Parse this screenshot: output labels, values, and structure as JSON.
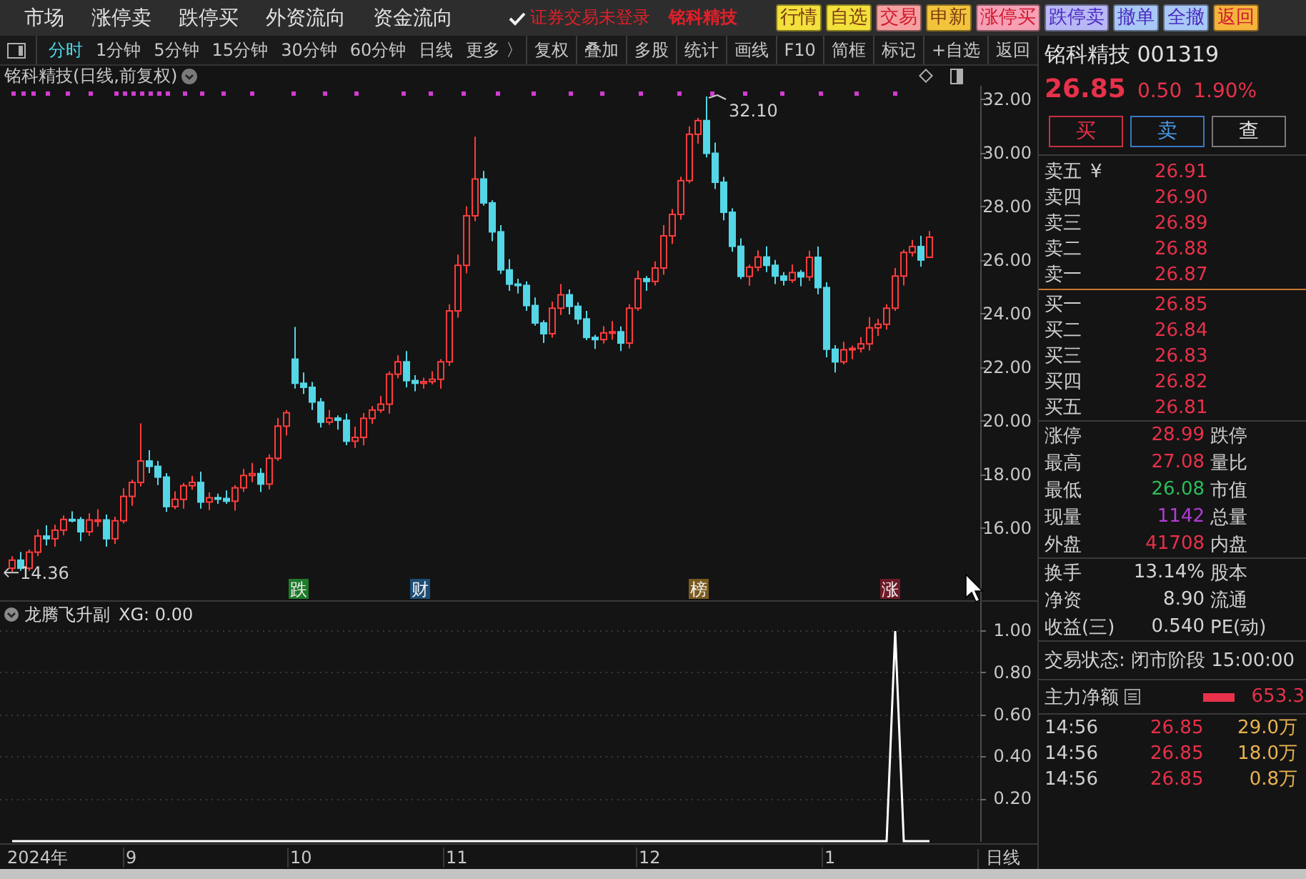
{
  "top_menu": {
    "items": [
      "市场",
      "涨停卖",
      "跌停买",
      "外资流向",
      "资金流向"
    ],
    "login_notice": "证券交易未登录",
    "stock_name": "铭科精技",
    "quick_buttons": [
      {
        "label": "行情",
        "color": "#f2e03c"
      },
      {
        "label": "自选",
        "color": "#f2e03c"
      },
      {
        "label": "交易",
        "color": "#f5a0a0"
      },
      {
        "label": "申新",
        "color": "#f2c43c"
      },
      {
        "label": "涨停买",
        "color": "#f5a0b4"
      },
      {
        "label": "跌停卖",
        "color": "#b8b8f5"
      },
      {
        "label": "撤单",
        "color": "#a8c8f5"
      },
      {
        "label": "全撤",
        "color": "#a8c8f5"
      },
      {
        "label": "返回",
        "color": "#f5b43c"
      }
    ]
  },
  "toolbar": {
    "periods": [
      {
        "label": "分时",
        "selected": true
      },
      {
        "label": "1分钟",
        "selected": false
      },
      {
        "label": "5分钟",
        "selected": false
      },
      {
        "label": "15分钟",
        "selected": false
      },
      {
        "label": "30分钟",
        "selected": false
      },
      {
        "label": "60分钟",
        "selected": false
      },
      {
        "label": "日线",
        "selected": false
      },
      {
        "label": "更多 〉",
        "selected": false
      }
    ],
    "tools": [
      "复权",
      "叠加",
      "多股",
      "统计",
      "画线",
      "F10",
      "简框",
      "标记",
      "+自选",
      "返回"
    ]
  },
  "chart": {
    "title": "铭科精技(日线,前复权)",
    "high_label": "32.10",
    "low_label": "14.36",
    "events": [
      {
        "label": "跌",
        "color": "#1f7a2a"
      },
      {
        "label": "财",
        "color": "#1d4d75"
      },
      {
        "label": "榜",
        "color": "#7a5a1e"
      },
      {
        "label": "涨",
        "color": "#6e1a28"
      }
    ],
    "chart_data": {
      "type": "candlestick",
      "ylim": [
        13.25,
        32.5
      ],
      "yticks": [
        {
          "value": 32,
          "label": "32.00"
        },
        {
          "value": 30,
          "label": "30.00"
        },
        {
          "value": 28,
          "label": "28.00"
        },
        {
          "value": 26,
          "label": "26.00"
        },
        {
          "value": 24,
          "label": "24.00"
        },
        {
          "value": 22,
          "label": "22.00"
        },
        {
          "value": 20,
          "label": "20.00"
        },
        {
          "value": 18,
          "label": "18.00"
        },
        {
          "value": 16,
          "label": "16.00"
        }
      ],
      "ohlc": [
        [
          14.5,
          14.95,
          14.36,
          14.8
        ],
        [
          14.8,
          15.1,
          14.4,
          14.5
        ],
        [
          14.5,
          15.2,
          14.4,
          15.1
        ],
        [
          15.1,
          15.95,
          14.95,
          15.7
        ],
        [
          15.7,
          16.1,
          15.35,
          15.6
        ],
        [
          15.6,
          16.12,
          15.3,
          15.92
        ],
        [
          15.92,
          16.47,
          15.72,
          16.32
        ],
        [
          16.32,
          16.62,
          16.21,
          16.31
        ],
        [
          16.31,
          16.41,
          15.51,
          15.86
        ],
        [
          15.86,
          16.55,
          15.71,
          16.3
        ],
        [
          16.3,
          16.7,
          16.05,
          16.3
        ],
        [
          16.3,
          16.5,
          15.3,
          15.6
        ],
        [
          15.6,
          16.42,
          15.4,
          16.27
        ],
        [
          16.27,
          17.48,
          16.17,
          17.18
        ],
        [
          17.18,
          17.8,
          16.83,
          17.7
        ],
        [
          17.7,
          19.9,
          17.55,
          18.5
        ],
        [
          18.5,
          18.9,
          18.05,
          18.3
        ],
        [
          18.3,
          18.5,
          17.6,
          17.9
        ],
        [
          17.9,
          18.05,
          16.6,
          16.8
        ],
        [
          16.8,
          17.37,
          16.7,
          17.07
        ],
        [
          17.07,
          17.68,
          16.72,
          17.58
        ],
        [
          17.58,
          17.95,
          17.43,
          17.7
        ],
        [
          17.7,
          18.1,
          16.72,
          16.97
        ],
        [
          16.97,
          17.33,
          16.67,
          17.13
        ],
        [
          17.13,
          17.28,
          16.9,
          17.1
        ],
        [
          17.1,
          17.4,
          16.9,
          17.0
        ],
        [
          17.0,
          17.6,
          16.65,
          17.5
        ],
        [
          17.5,
          18.21,
          17.35,
          17.96
        ],
        [
          17.96,
          18.43,
          17.71,
          18.03
        ],
        [
          18.03,
          18.23,
          17.34,
          17.64
        ],
        [
          17.64,
          18.75,
          17.44,
          18.6
        ],
        [
          18.6,
          20.1,
          18.5,
          19.8
        ],
        [
          19.8,
          20.4,
          19.45,
          20.3
        ],
        [
          22.3,
          23.5,
          21.2,
          21.4
        ],
        [
          21.4,
          21.8,
          21.0,
          21.25
        ],
        [
          21.25,
          21.45,
          20.4,
          20.7
        ],
        [
          20.7,
          20.85,
          19.75,
          19.95
        ],
        [
          19.95,
          20.4,
          19.85,
          20.1
        ],
        [
          20.1,
          20.2,
          19.67,
          20.02
        ],
        [
          20.02,
          20.27,
          19.09,
          19.24
        ],
        [
          19.24,
          19.78,
          18.99,
          19.38
        ],
        [
          19.38,
          20.29,
          19.08,
          20.09
        ],
        [
          20.09,
          20.55,
          19.89,
          20.4
        ],
        [
          20.4,
          20.92,
          20.3,
          20.62
        ],
        [
          20.62,
          21.84,
          20.27,
          21.74
        ],
        [
          21.74,
          22.45,
          21.59,
          22.2
        ],
        [
          22.2,
          22.6,
          21.25,
          21.5
        ],
        [
          21.5,
          21.7,
          21.1,
          21.4
        ],
        [
          21.4,
          21.61,
          21.2,
          21.46
        ],
        [
          21.46,
          21.85,
          21.36,
          21.55
        ],
        [
          21.55,
          22.3,
          21.2,
          22.2
        ],
        [
          22.2,
          24.35,
          22.05,
          24.1
        ],
        [
          24.1,
          26.2,
          23.85,
          25.8
        ],
        [
          25.8,
          28.0,
          25.5,
          27.65
        ],
        [
          27.65,
          30.6,
          27.45,
          29.02
        ],
        [
          29.02,
          29.32,
          28.03,
          28.13
        ],
        [
          28.13,
          28.23,
          26.7,
          27.05
        ],
        [
          27.05,
          27.3,
          25.48,
          25.63
        ],
        [
          25.63,
          26.03,
          24.85,
          25.1
        ],
        [
          25.1,
          25.3,
          24.75,
          25.05
        ],
        [
          25.05,
          25.2,
          24.1,
          24.3
        ],
        [
          24.3,
          24.6,
          23.55,
          23.65
        ],
        [
          23.65,
          23.75,
          22.9,
          23.25
        ],
        [
          23.25,
          24.45,
          23.1,
          24.2
        ],
        [
          24.2,
          25.1,
          23.95,
          24.7
        ],
        [
          24.7,
          24.9,
          23.97,
          24.27
        ],
        [
          24.27,
          24.42,
          23.6,
          23.8
        ],
        [
          23.8,
          24.1,
          23.01,
          23.11
        ],
        [
          23.11,
          23.21,
          22.68,
          23.03
        ],
        [
          23.03,
          23.53,
          22.88,
          23.28
        ],
        [
          23.28,
          23.72,
          23.03,
          23.32
        ],
        [
          23.32,
          23.52,
          22.6,
          22.9
        ],
        [
          22.9,
          24.35,
          22.7,
          24.2
        ],
        [
          24.2,
          25.6,
          24.1,
          25.3
        ],
        [
          25.3,
          25.4,
          24.85,
          25.2
        ],
        [
          25.2,
          25.95,
          25.05,
          25.7
        ],
        [
          25.7,
          27.3,
          25.45,
          26.9
        ],
        [
          26.9,
          27.9,
          26.6,
          27.7
        ],
        [
          27.7,
          29.11,
          27.5,
          28.96
        ],
        [
          28.96,
          30.99,
          28.86,
          30.69
        ],
        [
          30.69,
          31.3,
          30.34,
          31.2
        ],
        [
          31.2,
          32.1,
          29.83,
          29.98
        ],
        [
          29.98,
          30.38,
          28.65,
          28.9
        ],
        [
          28.9,
          29.1,
          27.48,
          27.78
        ],
        [
          27.78,
          27.93,
          26.31,
          26.51
        ],
        [
          26.51,
          26.81,
          25.29,
          25.39
        ],
        [
          25.39,
          25.83,
          25.04,
          25.73
        ],
        [
          25.73,
          26.36,
          25.58,
          26.11
        ],
        [
          26.11,
          26.51,
          25.55,
          25.8
        ],
        [
          25.8,
          26.0,
          25.1,
          25.4
        ],
        [
          25.4,
          25.55,
          25.05,
          25.25
        ],
        [
          25.25,
          25.83,
          25.15,
          25.53
        ],
        [
          25.53,
          25.63,
          25.02,
          25.37
        ],
        [
          25.37,
          26.35,
          25.22,
          26.1
        ],
        [
          26.1,
          26.5,
          24.72,
          24.97
        ],
        [
          24.97,
          25.17,
          22.37,
          22.67
        ],
        [
          22.67,
          22.82,
          21.8,
          22.2
        ],
        [
          22.2,
          22.95,
          22.1,
          22.65
        ],
        [
          22.65,
          22.8,
          22.3,
          22.7
        ],
        [
          22.7,
          23.12,
          22.55,
          22.87
        ],
        [
          22.87,
          23.87,
          22.62,
          23.47
        ],
        [
          23.47,
          23.8,
          23.17,
          23.6
        ],
        [
          23.6,
          24.35,
          23.4,
          24.2
        ],
        [
          24.2,
          25.7,
          24.1,
          25.4
        ],
        [
          25.4,
          26.38,
          25.05,
          26.28
        ],
        [
          26.28,
          26.75,
          26.13,
          26.5
        ],
        [
          26.5,
          26.9,
          25.75,
          26.0
        ],
        [
          26.1,
          27.08,
          26.08,
          26.85
        ]
      ]
    }
  },
  "indicator": {
    "name": "龙腾飞升副",
    "reading": "XG: 0.00",
    "chart_data": {
      "type": "line",
      "grid": true,
      "ylim": [
        0,
        1
      ],
      "yticks": [
        {
          "value": 1,
          "label": "1.00"
        },
        {
          "value": 0.8,
          "label": "0.80"
        },
        {
          "value": 0.6,
          "label": "0.60"
        },
        {
          "value": 0.4,
          "label": "0.40"
        },
        {
          "value": 0.2,
          "label": "0.20"
        }
      ],
      "values": [
        0,
        0,
        0,
        0,
        0,
        0,
        0,
        0,
        0,
        0,
        0,
        0,
        0,
        0,
        0,
        0,
        0,
        0,
        0,
        0,
        0,
        0,
        0,
        0,
        0,
        0,
        0,
        0,
        0,
        0,
        0,
        0,
        0,
        0,
        0,
        0,
        0,
        0,
        0,
        0,
        0,
        0,
        0,
        0,
        0,
        0,
        0,
        0,
        0,
        0,
        0,
        0,
        0,
        0,
        0,
        0,
        0,
        0,
        0,
        0,
        0,
        0,
        0,
        0,
        0,
        0,
        0,
        0,
        0,
        0,
        0,
        0,
        0,
        0,
        0,
        0,
        0,
        0,
        0,
        0,
        0,
        0,
        0,
        0,
        0,
        0,
        0,
        0,
        0,
        0,
        0,
        0,
        0,
        0,
        0,
        0,
        0,
        0,
        0,
        0,
        0,
        0,
        0,
        1,
        0,
        0,
        0,
        0
      ]
    }
  },
  "x_axis": {
    "labels": [
      "2024年",
      "9",
      "10",
      "11",
      "12",
      "1"
    ],
    "period": "日线"
  },
  "quote": {
    "title": "铭科精技 001319",
    "price": "26.85",
    "change": "0.50",
    "change_pct": "1.90%",
    "trade_buttons": [
      {
        "label": "买",
        "kind": "buy"
      },
      {
        "label": "卖",
        "kind": "sell"
      },
      {
        "label": "查",
        "kind": "query"
      }
    ],
    "currency_mark": "¥",
    "asks": [
      {
        "label": "卖五",
        "price": "26.91"
      },
      {
        "label": "卖四",
        "price": "26.90"
      },
      {
        "label": "卖三",
        "price": "26.89"
      },
      {
        "label": "卖二",
        "price": "26.88"
      },
      {
        "label": "卖一",
        "price": "26.87"
      }
    ],
    "bids": [
      {
        "label": "买一",
        "price": "26.85"
      },
      {
        "label": "买二",
        "price": "26.84"
      },
      {
        "label": "买三",
        "price": "26.83"
      },
      {
        "label": "买四",
        "price": "26.82"
      },
      {
        "label": "买五",
        "price": "26.81"
      }
    ],
    "stat_groups": [
      {
        "rows": [
          {
            "label": "涨停",
            "value": "28.99",
            "color": "#e8314a",
            "label_2": "跌停"
          },
          {
            "label": "最高",
            "value": "27.08",
            "color": "#e8314a",
            "label_2": "量比"
          },
          {
            "label": "最低",
            "value": "26.08",
            "color": "#2bbf5a",
            "label_2": "市值"
          },
          {
            "label": "现量",
            "value": "1142",
            "color": "#b23cd6",
            "label_2": "总量"
          },
          {
            "label": "外盘",
            "value": "41708",
            "color": "#e8314a",
            "label_2": "内盘"
          }
        ]
      },
      {
        "rows": [
          {
            "label": "换手",
            "value": "13.14%",
            "color": "#d4d4d4",
            "label_2": "股本"
          },
          {
            "label": "净资",
            "value": "8.90",
            "color": "#d4d4d4",
            "label_2": "流通"
          },
          {
            "label": "收益(三)",
            "value": "0.540",
            "color": "#d4d4d4",
            "label_2": "PE(动)"
          }
        ]
      }
    ],
    "trade_status": "交易状态: 闭市阶段 15:00:00",
    "net_flow": {
      "label": "主力净额",
      "value": "653.3"
    },
    "ticks": [
      {
        "time": "14:56",
        "price": "26.85",
        "volume": "29.0万"
      },
      {
        "time": "14:56",
        "price": "26.85",
        "volume": "18.0万"
      },
      {
        "time": "14:56",
        "price": "26.85",
        "volume": "0.8万"
      }
    ]
  }
}
